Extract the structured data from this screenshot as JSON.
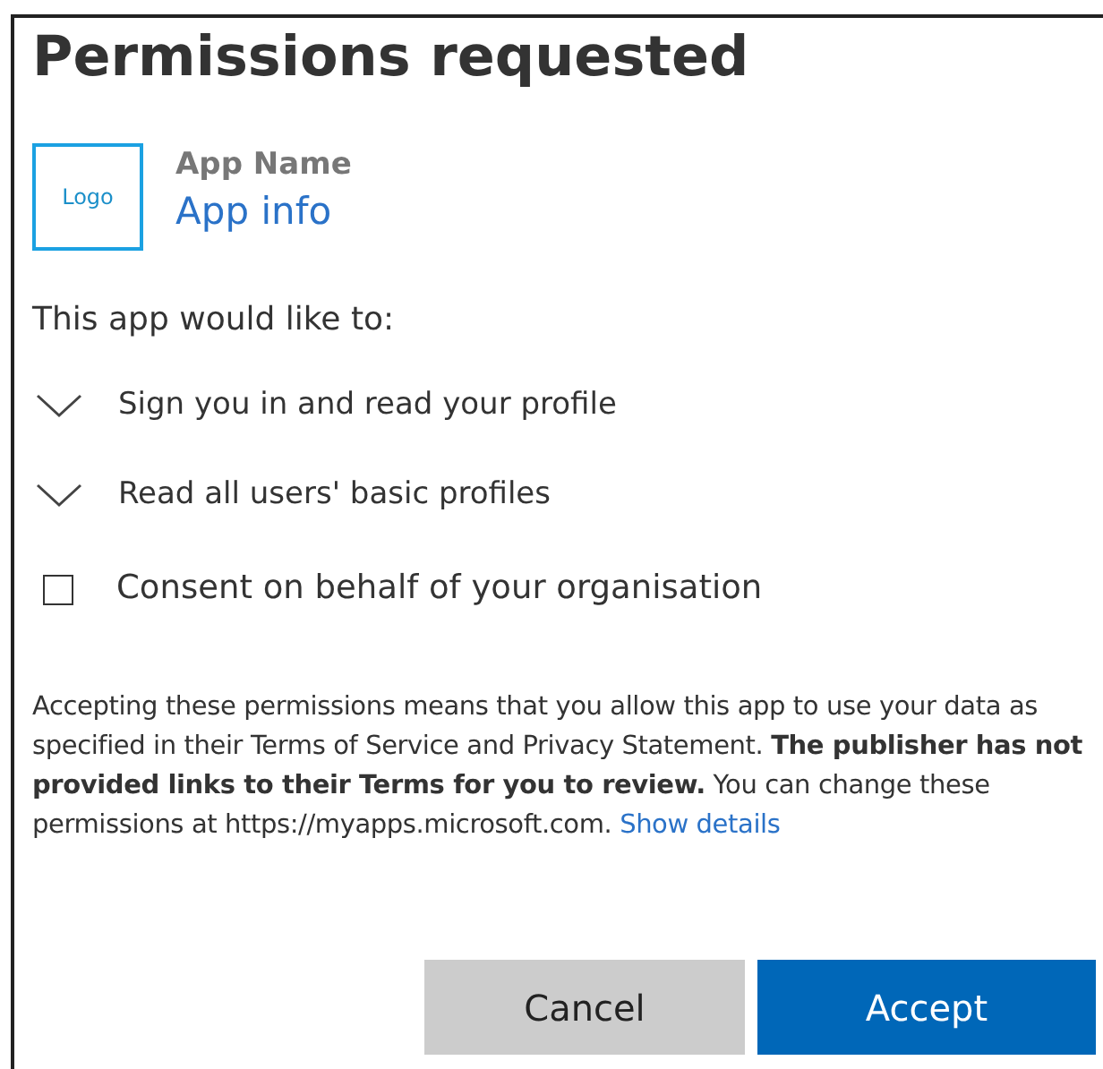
{
  "dialog": {
    "title": "Permissions requested"
  },
  "app": {
    "logo": "Logo",
    "name": "App Name",
    "info_link": "App info"
  },
  "intro": "This app would like to:",
  "permissions": [
    {
      "kind": "expander",
      "label": "Sign you in and read your profile",
      "expanded": false
    },
    {
      "kind": "expander",
      "label": "Read all users' basic profiles",
      "expanded": false
    },
    {
      "kind": "checkbox",
      "label": "Consent on behalf of your organisation",
      "checked": false
    }
  ],
  "notice": {
    "text": "Accepting these permissions means that you allow this app to use your data as specified in their Terms of Service and Privacy Statement. **The publisher has not provided links to their Terms for you to review.** You can change these permissions at https://myapps.microsoft.com.",
    "link": "Show details"
  },
  "buttons": [
    {
      "kind": "secondary",
      "label": "Cancel"
    },
    {
      "kind": "primary",
      "label": "Accept"
    }
  ]
}
